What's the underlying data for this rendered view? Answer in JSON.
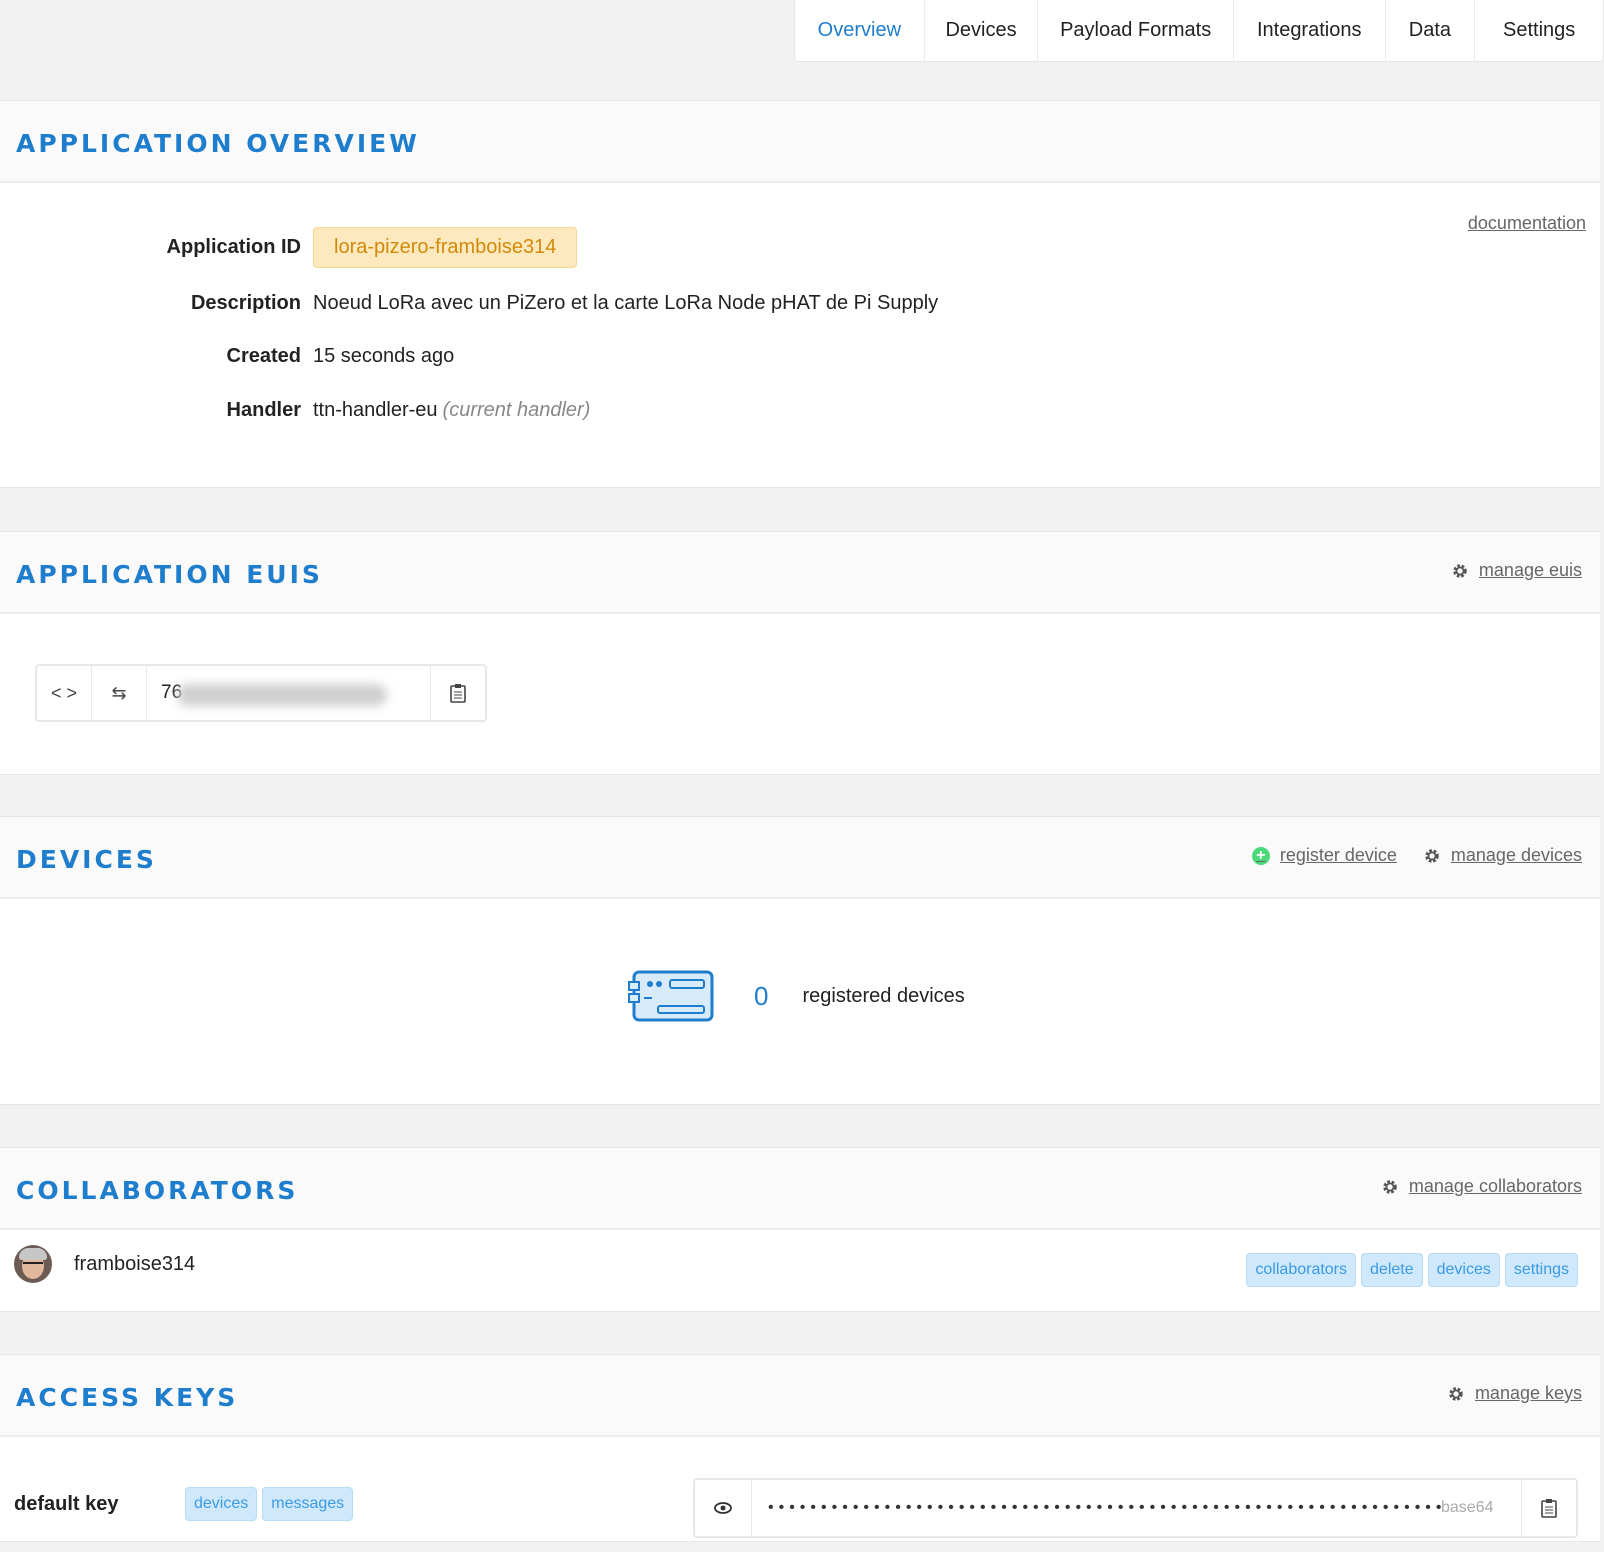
{
  "tabs": [
    {
      "label": "Overview"
    },
    {
      "label": "Devices"
    },
    {
      "label": "Payload Formats"
    },
    {
      "label": "Integrations"
    },
    {
      "label": "Data"
    },
    {
      "label": "Settings"
    }
  ],
  "overview": {
    "title": "APPLICATION OVERVIEW",
    "documentation_link": "documentation",
    "fields": {
      "app_id_label": "Application ID",
      "app_id_value": "lora-pizero-framboise314",
      "description_label": "Description",
      "description_value": "Noeud LoRa avec un PiZero et la carte LoRa Node pHAT de Pi Supply",
      "created_label": "Created",
      "created_value": "15 seconds ago",
      "handler_label": "Handler",
      "handler_value": "ttn-handler-eu",
      "handler_note": "(current handler)"
    }
  },
  "euis": {
    "title": "APPLICATION EUIS",
    "manage_link": "manage euis",
    "eui_visible_prefix": "76"
  },
  "devices": {
    "title": "DEVICES",
    "register_link": "register device",
    "manage_link": "manage devices",
    "count": "0",
    "count_label": "registered devices"
  },
  "collaborators": {
    "title": "COLLABORATORS",
    "manage_link": "manage collaborators",
    "items": [
      {
        "name": "framboise314",
        "rights": [
          "collaborators",
          "delete",
          "devices",
          "settings"
        ]
      }
    ]
  },
  "access_keys": {
    "title": "ACCESS KEYS",
    "manage_link": "manage keys",
    "keys": [
      {
        "name": "default key",
        "rights": [
          "devices",
          "messages"
        ],
        "masked_value": "••••••••••••••••••••••••••••••••••••••••••••••••••••••••••••••••",
        "encoding": "base64"
      }
    ]
  },
  "colors": {
    "accent": "#1e7dcc",
    "app_id_bg": "#fde9bd",
    "chip_bg": "#cfe8fb",
    "add_green": "#4cd97a"
  },
  "icons": {
    "eui_format": "code-brackets-icon",
    "eui_swap": "swap-arrows-icon",
    "copy": "clipboard-icon",
    "reveal": "eye-icon",
    "manage": "gear-icon",
    "add": "plus-circle-icon",
    "device": "device-board-icon"
  }
}
